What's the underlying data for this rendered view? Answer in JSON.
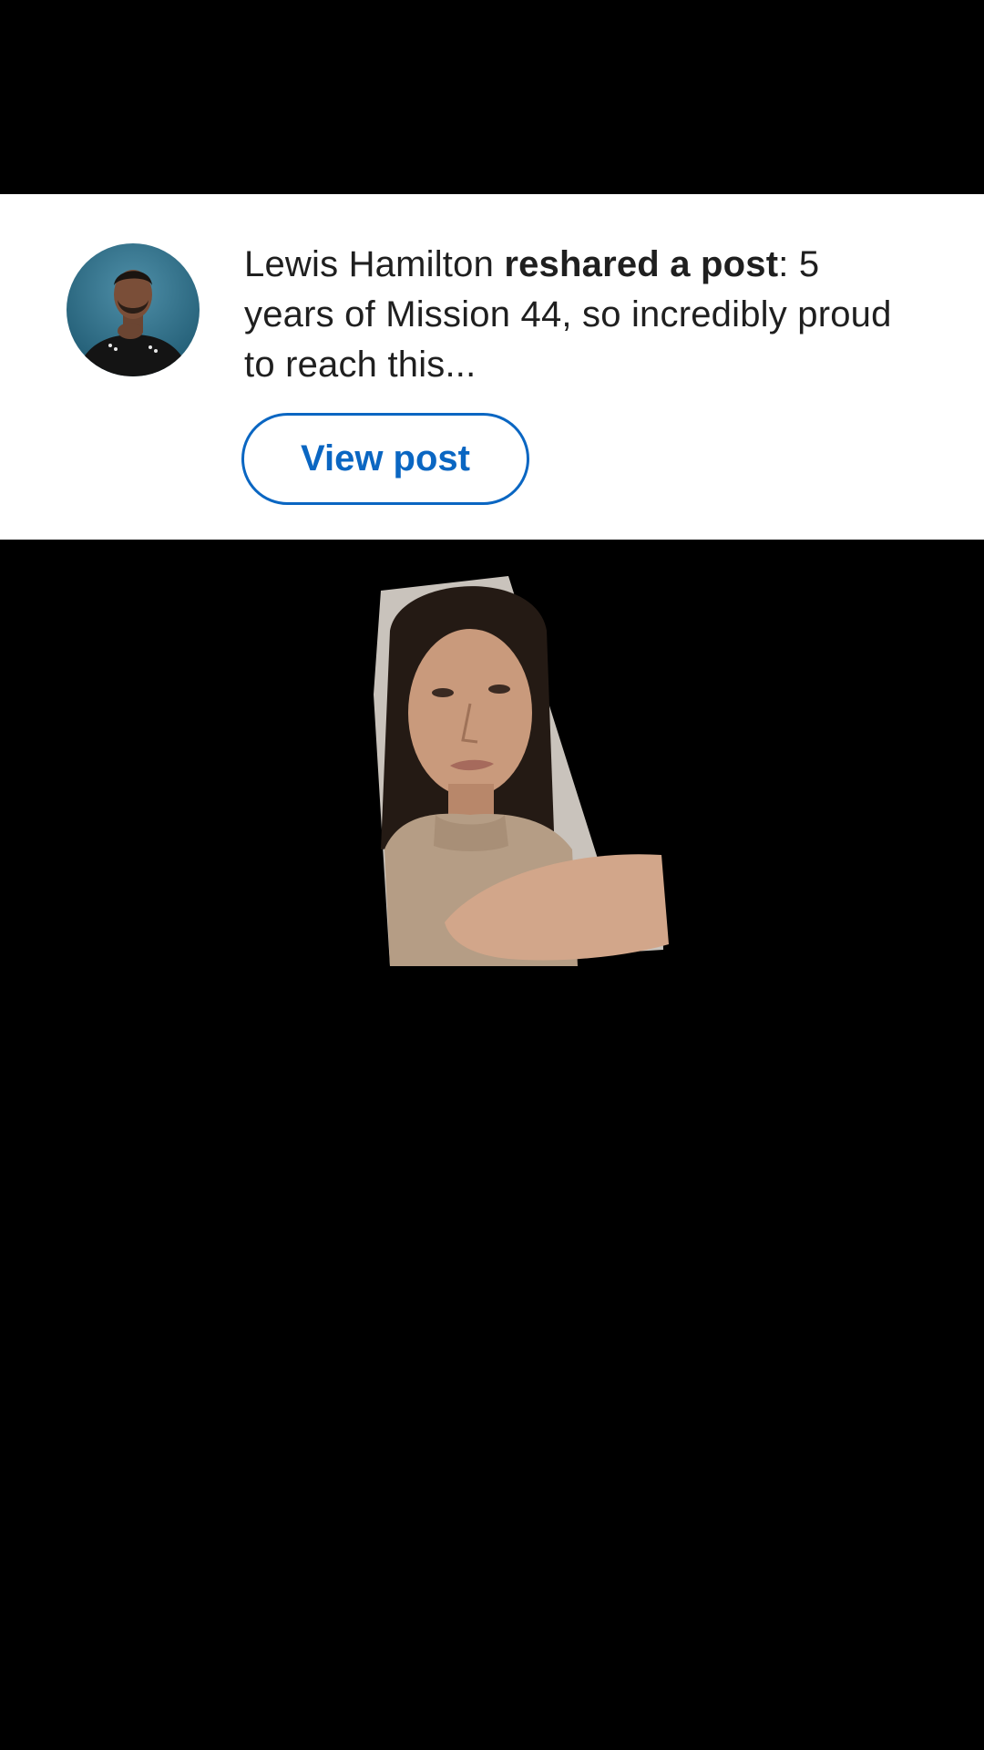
{
  "notification": {
    "author": "Lewis Hamilton",
    "action": "reshared a post",
    "separator": ":",
    "post_excerpt": "5 years of Mission 44, so incredibly proud to reach this...",
    "button_label": "View post",
    "avatar_icon": "profile-photo-avatar"
  },
  "video": {
    "icon": "video-frame-person"
  },
  "colors": {
    "background": "#000000",
    "card": "#ffffff",
    "accent": "#0a66c2",
    "text": "#1f1f1f"
  }
}
